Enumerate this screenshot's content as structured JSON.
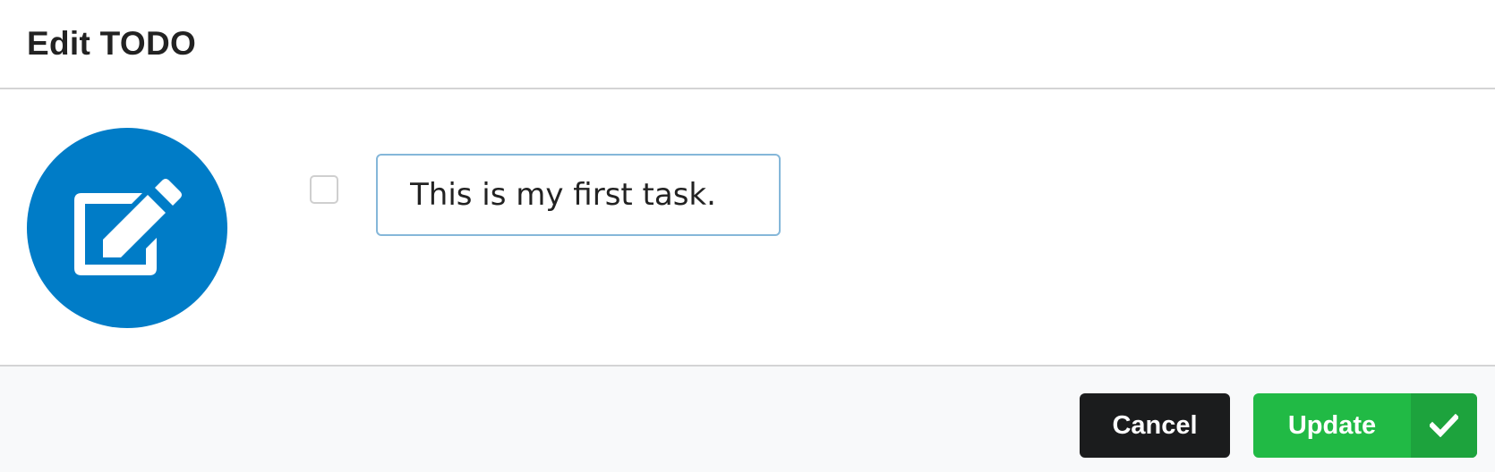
{
  "header": {
    "title": "Edit TODO"
  },
  "content": {
    "image_icon": "edit-icon",
    "image_color": "#007cc7",
    "completed_checkbox": false,
    "task_input": {
      "value": "This is my first task."
    }
  },
  "actions": {
    "cancel_label": "Cancel",
    "update_label": "Update",
    "update_icon": "checkmark-icon",
    "cancel_color": "#1b1c1d",
    "update_color": "#21ba45"
  }
}
